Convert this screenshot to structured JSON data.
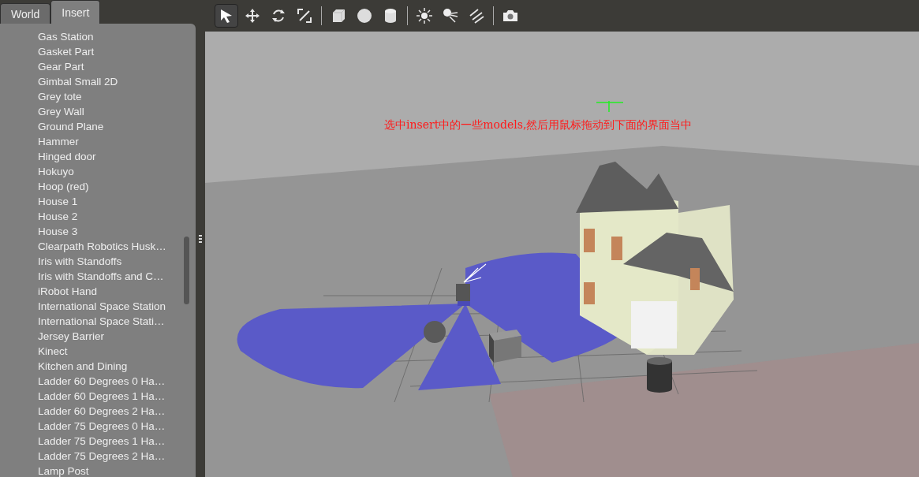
{
  "tabs": [
    {
      "label": "World",
      "selected": false
    },
    {
      "label": "Insert",
      "selected": true
    }
  ],
  "models": [
    "Gas Station",
    "Gasket Part",
    "Gear Part",
    "Gimbal Small 2D",
    "Grey tote",
    "Grey Wall",
    "Ground Plane",
    "Hammer",
    "Hinged door",
    "Hokuyo",
    "Hoop (red)",
    "House 1",
    "House 2",
    "House 3",
    "Clearpath Robotics Husk…",
    "Iris with Standoffs",
    "Iris with Standoffs and C…",
    "iRobot Hand",
    "International Space Station",
    "International Space Stati…",
    "Jersey Barrier",
    "Kinect",
    "Kitchen and Dining",
    "Ladder 60 Degrees 0 Ha…",
    "Ladder 60 Degrees 1 Ha…",
    "Ladder 60 Degrees 2 Ha…",
    "Ladder 75 Degrees 0 Ha…",
    "Ladder 75 Degrees 1 Ha…",
    "Ladder 75 Degrees 2 Ha…",
    "Lamp Post"
  ],
  "toolbar": [
    {
      "kind": "select",
      "selected": true
    },
    {
      "kind": "translate",
      "selected": false
    },
    {
      "kind": "rotate",
      "selected": false
    },
    {
      "kind": "scale",
      "selected": false
    },
    {
      "kind": "separator"
    },
    {
      "kind": "box",
      "selected": false
    },
    {
      "kind": "sphere",
      "selected": false
    },
    {
      "kind": "cylinder",
      "selected": false
    },
    {
      "kind": "separator"
    },
    {
      "kind": "pointlight",
      "selected": false
    },
    {
      "kind": "spotlight",
      "selected": false
    },
    {
      "kind": "dirlight",
      "selected": false
    },
    {
      "kind": "separator"
    },
    {
      "kind": "screenshot",
      "selected": false
    }
  ],
  "viewport": {
    "annotation": "选中insert中的一些models,然后用鼠标拖动到下面的界面当中"
  }
}
